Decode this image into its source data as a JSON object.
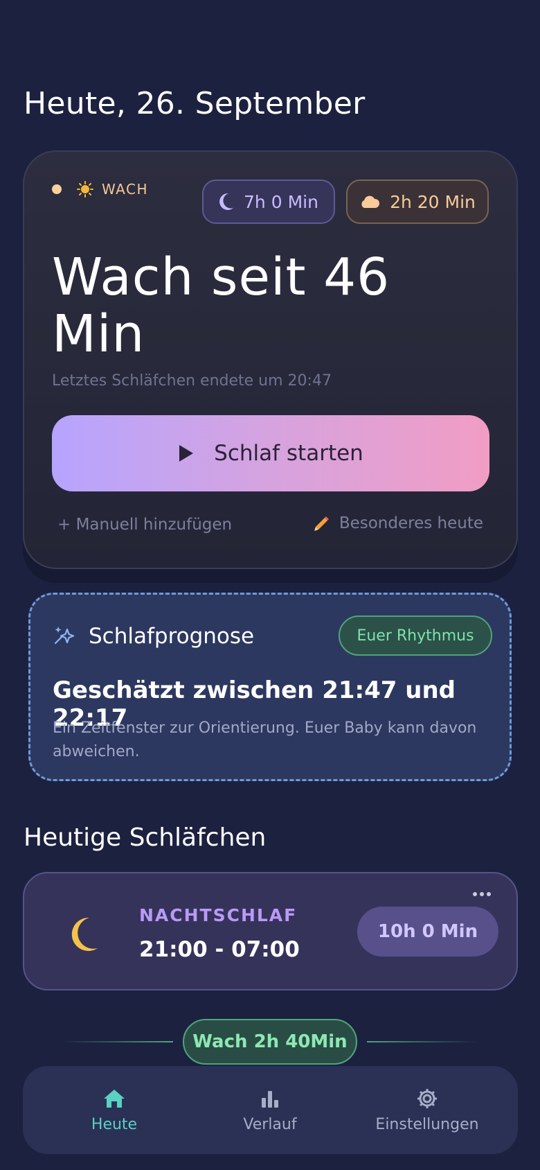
{
  "header": {
    "date_title": "Heute, 26. September"
  },
  "status_card": {
    "state_label": "WACH",
    "night_sleep_total": "7h 0 Min",
    "day_sleep_total": "2h 20 Min",
    "awake_heading": "Wach seit 46 Min",
    "last_nap_text": "Letztes Schläfchen endete um 20:47",
    "start_button_label": "Schlaf starten",
    "manual_add_label": "+ Manuell hinzufügen",
    "special_today_label": "Besonderes heute",
    "colors": {
      "accent_start": "#b6a4ff",
      "accent_end": "#f19dc4",
      "wake": "#f5c796"
    }
  },
  "forecast": {
    "title": "Schlafprognose",
    "badge": "Euer Rhythmus",
    "range": "Geschätzt zwischen 21:47 und 22:17",
    "note": "Ein Zeitfenster zur Orientierung. Euer Baby kann davon abweichen."
  },
  "naps_section": {
    "title": "Heutige Schläfchen",
    "items": [
      {
        "type": "NACHTSCHLAF",
        "time": "21:00 - 07:00",
        "duration": "10h 0 Min",
        "icon": "moon-icon"
      }
    ],
    "awake_gap": "Wach 2h 40Min"
  },
  "bottom_nav": {
    "items": [
      {
        "label": "Heute",
        "icon": "home-icon",
        "active": true
      },
      {
        "label": "Verlauf",
        "icon": "bar-chart-icon",
        "active": false
      },
      {
        "label": "Einstellungen",
        "icon": "gear-icon",
        "active": false
      }
    ],
    "active_color": "#5ad1c2"
  }
}
